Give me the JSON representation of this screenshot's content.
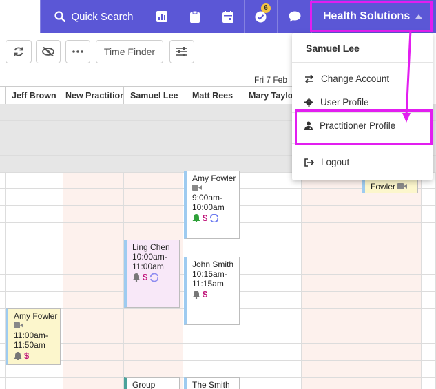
{
  "topnav": {
    "quick_search_label": "Quick Search",
    "notification_count": "6",
    "org_label": "Health Solutions"
  },
  "toolbar": {
    "time_finder_label": "Time Finder"
  },
  "calendar": {
    "date_label": "Fri 7 Feb",
    "columns": [
      "Jeff Brown",
      "New Practitioner",
      "Samuel Lee",
      "Matt Rees",
      "Mary Taylor"
    ]
  },
  "appointments": [
    {
      "name": "Amy Fowler",
      "time": "9:00am-10:00am"
    },
    {
      "name": "Ling Chen",
      "time": "10:00am-11:00am"
    },
    {
      "name": "John Smith",
      "time": "10:15am-11:15am"
    },
    {
      "name": "Amy Fowler",
      "time": "11:00am-11:50am"
    },
    {
      "name": "Group",
      "time": ""
    },
    {
      "name": "The Smith",
      "time": ""
    },
    {
      "name": "Fowler",
      "time": ""
    }
  ],
  "dropdown": {
    "user_name": "Samuel Lee",
    "items": [
      "Change Account",
      "User Profile",
      "Practitioner Profile",
      "Logout"
    ]
  }
}
